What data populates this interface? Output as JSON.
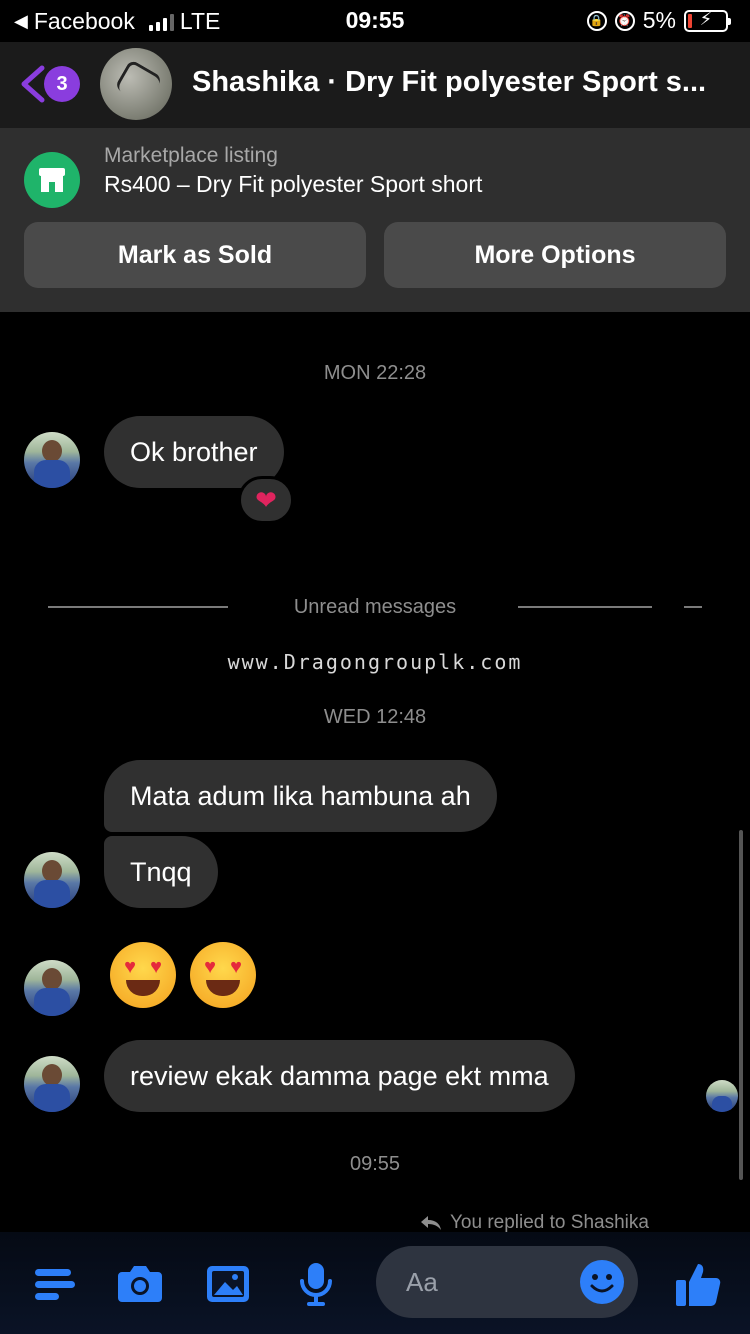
{
  "status_bar": {
    "back_app": "Facebook",
    "network": "LTE",
    "time": "09:55",
    "battery": "5%"
  },
  "header": {
    "unread_count": "3",
    "title": "Shashika · Dry Fit polyester Sport s..."
  },
  "listing": {
    "caption": "Marketplace listing",
    "price_title": "Rs400 – Dry Fit polyester Sport short",
    "buttons": {
      "mark_sold": "Mark as Sold",
      "more_options": "More Options"
    }
  },
  "chat": {
    "ts1": "MON 22:28",
    "msg1": "Ok brother",
    "reaction": "❤",
    "unread_divider": "Unread messages",
    "watermark": "www.Dragongrouplk.com",
    "ts2": "WED 12:48",
    "msg2": "Mata adum lika hambuna ah",
    "msg3": "Tnqq",
    "msg4": "review ekak damma page ekt mma",
    "ts3": "09:55",
    "reply_note": "You replied to Shashika"
  },
  "composer": {
    "placeholder": "Aa"
  },
  "colors": {
    "accent": "#2d7ff9",
    "badge": "#8a3dde",
    "market": "#1fb46a",
    "bubble": "#303030"
  }
}
